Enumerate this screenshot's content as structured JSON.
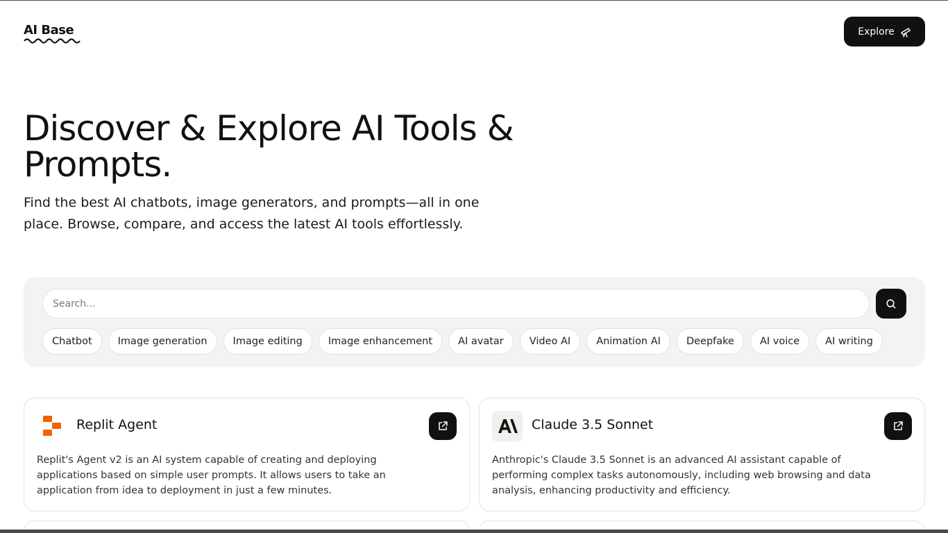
{
  "header": {
    "logo_text": "AI Base",
    "explore_label": "Explore"
  },
  "hero": {
    "title": "Discover & Explore AI Tools & Prompts.",
    "subtitle": "Find the best AI chatbots, image generators, and prompts—all in one place. Browse, compare, and access the latest AI tools effortlessly."
  },
  "search": {
    "placeholder": "Search..."
  },
  "categories": [
    "Chatbot",
    "Image generation",
    "Image editing",
    "Image enhancement",
    "AI avatar",
    "Video AI",
    "Animation AI",
    "Deepfake",
    "AI voice",
    "AI writing"
  ],
  "cards": [
    {
      "title": "Replit Agent",
      "description": "Replit's Agent v2 is an AI system capable of creating and deploying applications based on simple user prompts. It allows users to take an application from idea to deployment in just a few minutes.",
      "logo_icon": "replit-logo-icon"
    },
    {
      "title": "Claude 3.5 Sonnet",
      "description": "Anthropic's Claude 3.5 Sonnet is an advanced AI assistant capable of performing complex tasks autonomously, including web browsing and data analysis, enhancing productivity and efficiency.",
      "logo_icon": "anthropic-logo-icon"
    }
  ],
  "colors": {
    "primary_dark": "#111111",
    "panel_bg": "#f3f3f3",
    "replit_orange": "#f26207"
  }
}
